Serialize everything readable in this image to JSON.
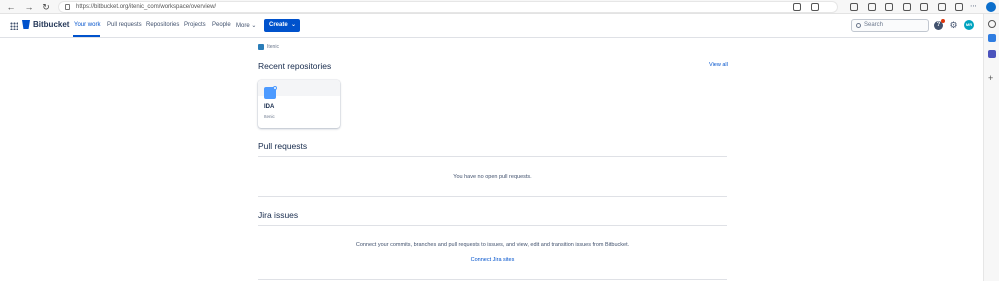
{
  "browser": {
    "url": "https://bitbucket.org/itenic_com/workspace/overview/"
  },
  "header": {
    "logo_text": "Bitbucket",
    "nav": [
      "Your work",
      "Pull requests",
      "Repositories",
      "Projects",
      "People",
      "More"
    ],
    "create_label": "Create",
    "search_placeholder": "Search",
    "avatar_initials": "MR"
  },
  "breadcrumb": {
    "workspace": "Itenic"
  },
  "recent": {
    "title": "Recent repositories",
    "view_all": "View all",
    "repo": {
      "name": "IDA",
      "workspace": "Itenic"
    }
  },
  "pull_requests": {
    "title": "Pull requests",
    "empty_text": "You have no open pull requests."
  },
  "jira": {
    "title": "Jira issues",
    "description": "Connect your commits, branches and pull requests to issues, and view, edit and transition issues from Bitbucket.",
    "link": "Connect Jira sites"
  },
  "colors": {
    "brand": "#0052cc",
    "text": "#172b4d",
    "muted": "#6b778c"
  }
}
